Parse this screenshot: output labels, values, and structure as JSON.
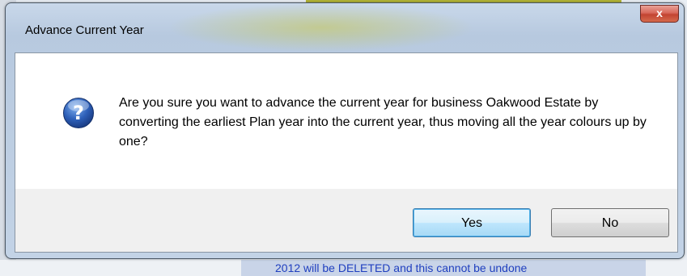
{
  "window": {
    "title": "Advance Current Year",
    "close_label": "x"
  },
  "message": "Are you sure you want to advance the current year for business Oakwood Estate by converting the earliest Plan year into the current year, thus moving all the year colours up by one?",
  "icon": "question-icon",
  "buttons": {
    "yes_label": "Yes",
    "no_label": "No"
  },
  "background": {
    "bottom_text": "2012 will be DELETED and this cannot be undone"
  },
  "colors": {
    "accent": "#3c7fb1",
    "close": "#c24331",
    "icon": "#2d5fb8"
  }
}
